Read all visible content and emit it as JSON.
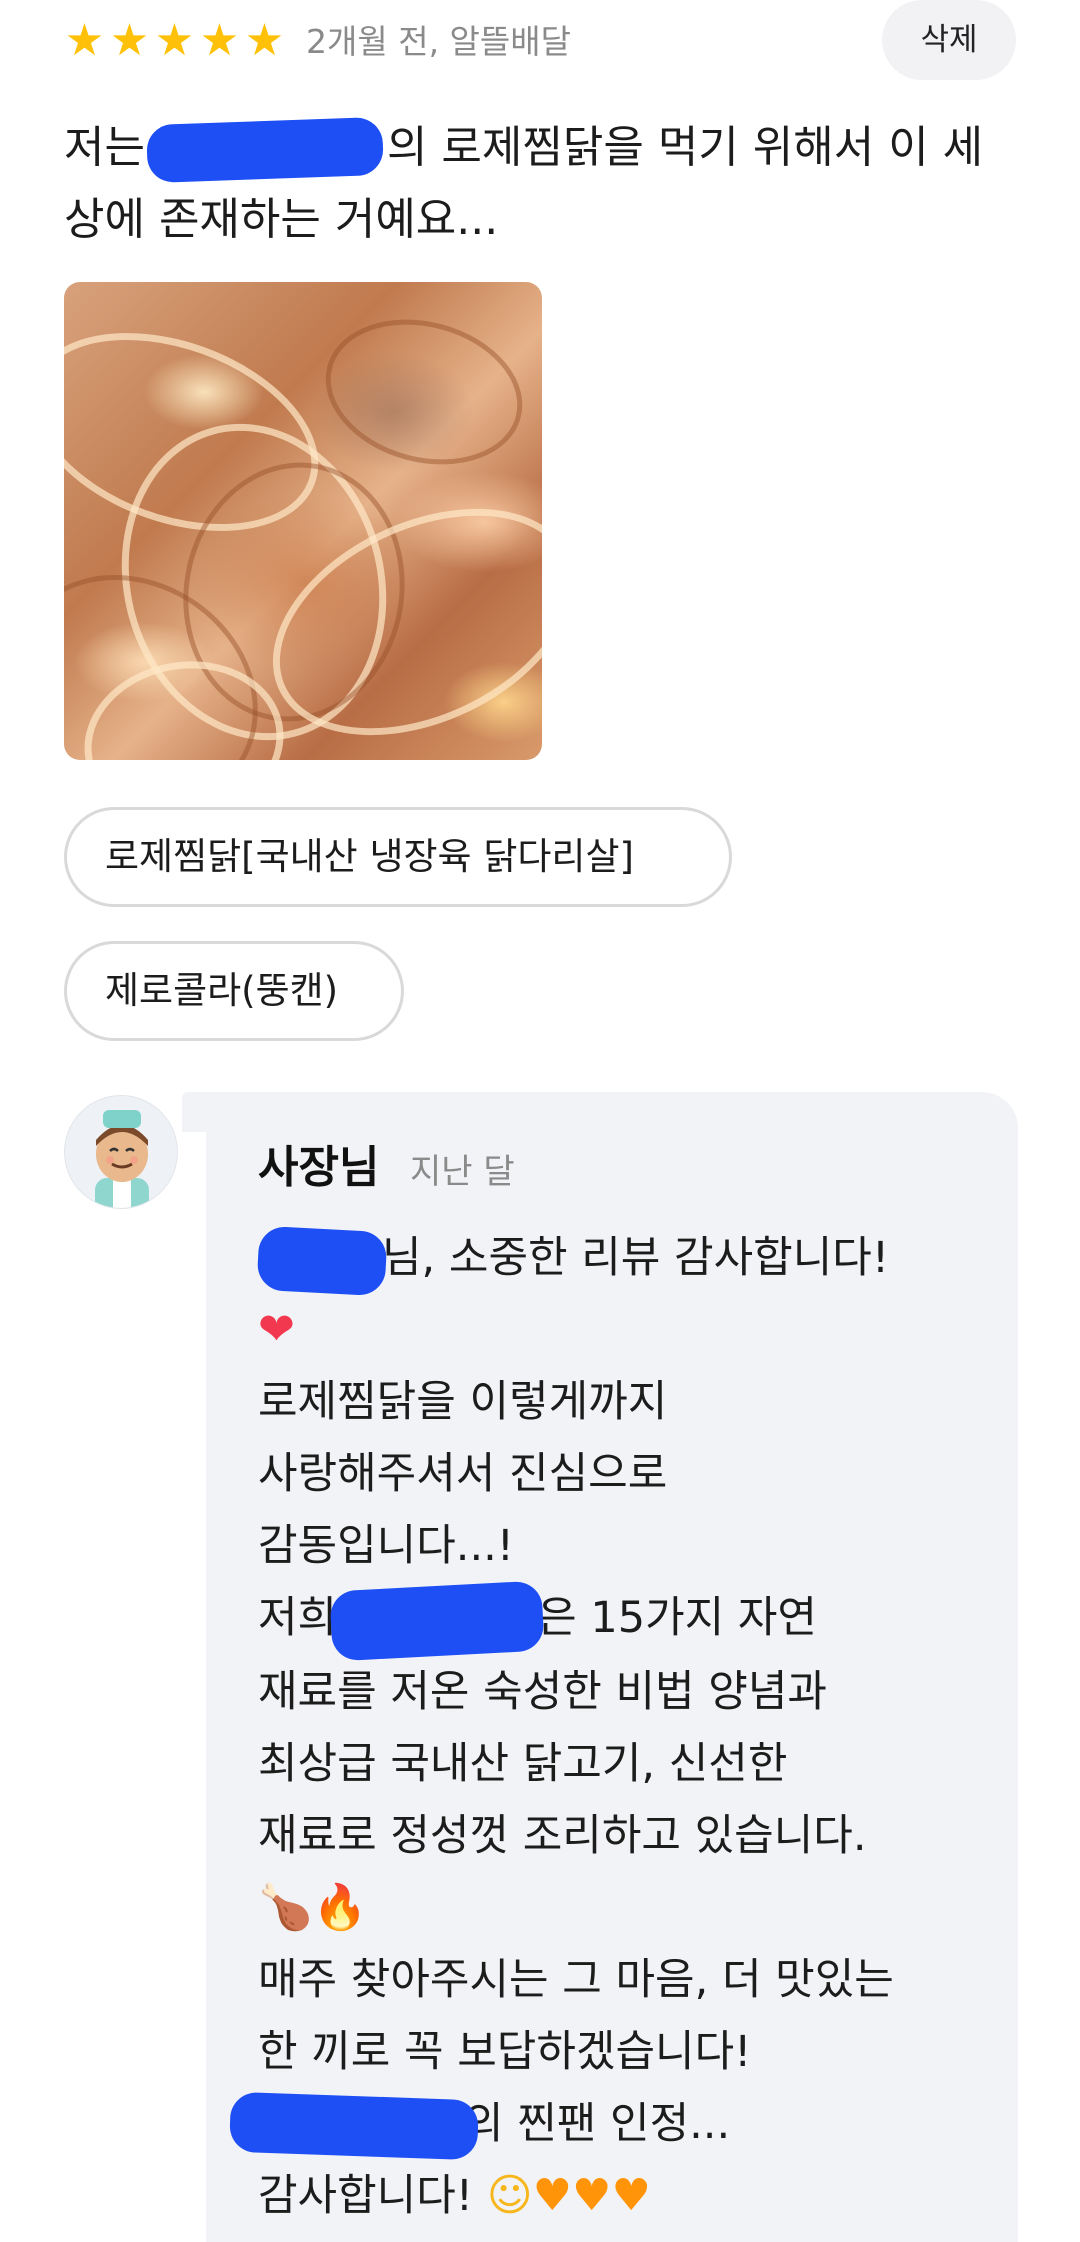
{
  "review": {
    "rating": 5,
    "stars": [
      "★",
      "★",
      "★",
      "★",
      "★"
    ],
    "meta": "2개월 전, 알뜰배달",
    "delete_label": "삭제",
    "text_before": "저는",
    "text_after": "의 로제찜닭을 먹기 위해서 이 세상에 존재하는 거예요...",
    "options": [
      "로제찜닭[국내산 냉장육 닭다리살]",
      "제로콜라(뚱캔)"
    ]
  },
  "reply": {
    "author": "사장님",
    "date": "지난 달",
    "line1_after": "님, 소중한 리뷰 감사합니다!",
    "line2_emoji": "❤",
    "line3": "로제찜닭을 이렇게까지",
    "line4": "사랑해주셔서 진심으로",
    "line5": "감동입니다...!",
    "line6_before": "저희",
    "line6_after": "은 15가지 자연",
    "line7": "재료를 저온 숙성한 비법 양념과",
    "line8": "최상급 국내산 닭고기, 신선한",
    "line9": "재료로 정성껏 조리하고 있습니다.",
    "line10_emoji1": "🍗",
    "line10_emoji2": "🔥",
    "line11": "매주 찾아주시는 그 마음, 더 맛있는",
    "line12": "한 끼로 꼭 보답하겠습니다!",
    "line13_after": "의 찐팬 인정...",
    "line14_text": "감사합니다!",
    "line14_emoji_smile": "☺",
    "line14_hearts": [
      "♥",
      "♥",
      "♥"
    ]
  },
  "colors": {
    "star": "#ffc107",
    "redaction": "#1e4ff5",
    "reply_bg": "#f2f3f6",
    "chip_border": "#d9d9d9"
  }
}
